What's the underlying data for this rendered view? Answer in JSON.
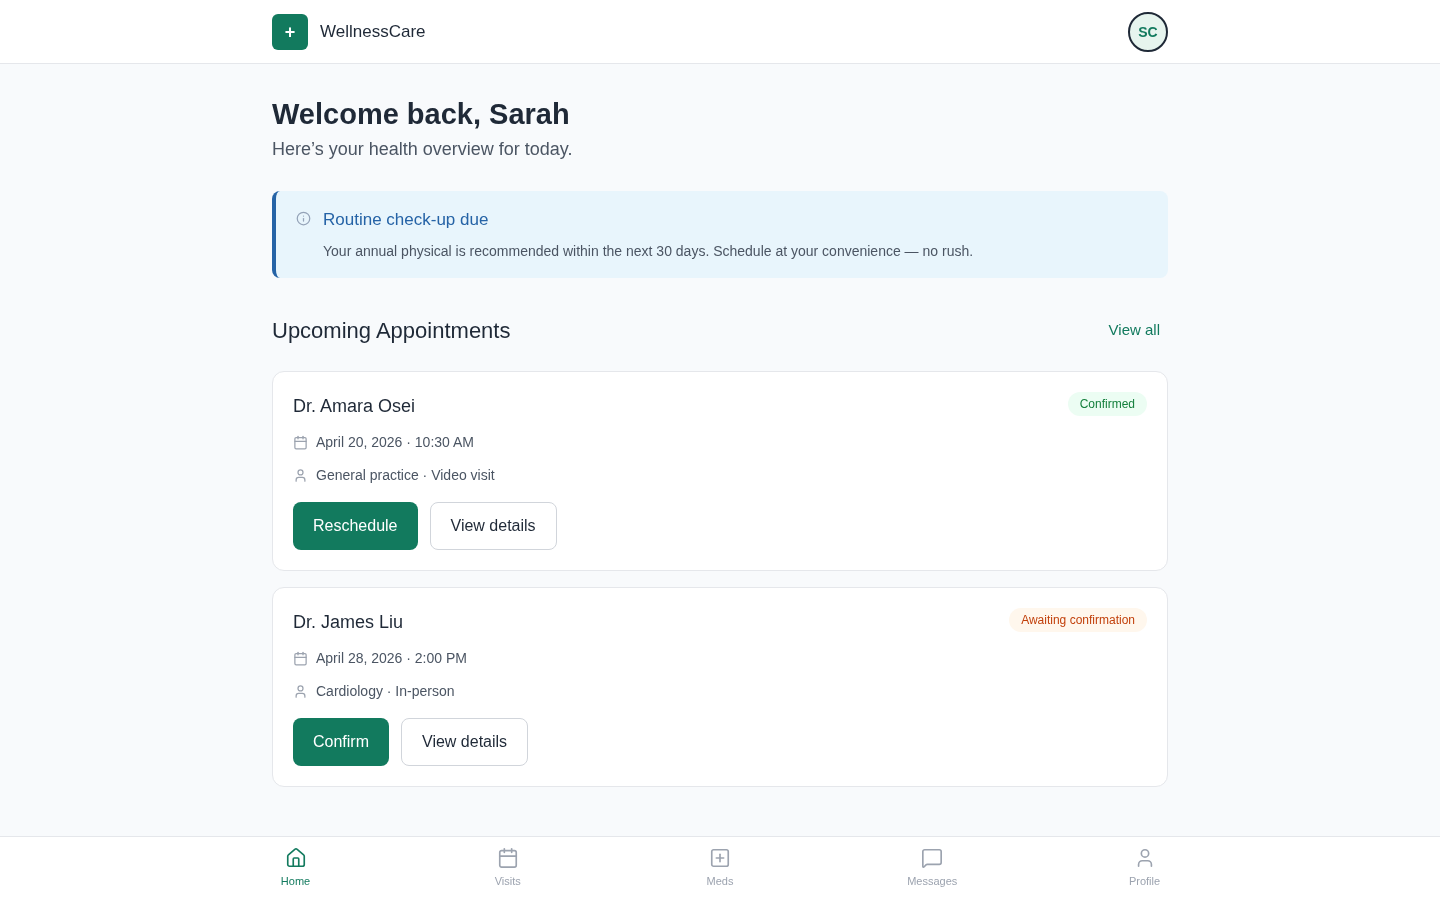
{
  "header": {
    "logo_symbol": "+",
    "brand": "WellnessCare",
    "avatar_initials": "SC"
  },
  "welcome": {
    "title": "Welcome back, Sarah",
    "subtitle": "Here’s your health overview for today."
  },
  "notice": {
    "title": "Routine check-up due",
    "text": "Your annual physical is recommended within the next 30 days. Schedule at your convenience — no rush."
  },
  "appointments": {
    "title": "Upcoming Appointments",
    "link": "View all",
    "items": [
      {
        "doctor": "Dr. Amara Osei",
        "status": "Confirmed",
        "kind": "confirmed",
        "datetime": "April 20, 2026 · 10:30 AM",
        "type": "General practice · Video visit",
        "primary_action": "Reschedule",
        "secondary_action": "View details"
      },
      {
        "doctor": "Dr. James Liu",
        "status": "Awaiting confirmation",
        "kind": "pending",
        "datetime": "April 28, 2026 · 2:00 PM",
        "type": "Cardiology · In-person",
        "primary_action": "Confirm",
        "secondary_action": "View details"
      }
    ]
  },
  "bottom_nav": [
    {
      "label": "Home",
      "selected": true
    },
    {
      "label": "Visits",
      "selected": false
    },
    {
      "label": "Meds",
      "selected": false
    },
    {
      "label": "Messages",
      "selected": false
    },
    {
      "label": "Profile",
      "selected": false
    }
  ]
}
